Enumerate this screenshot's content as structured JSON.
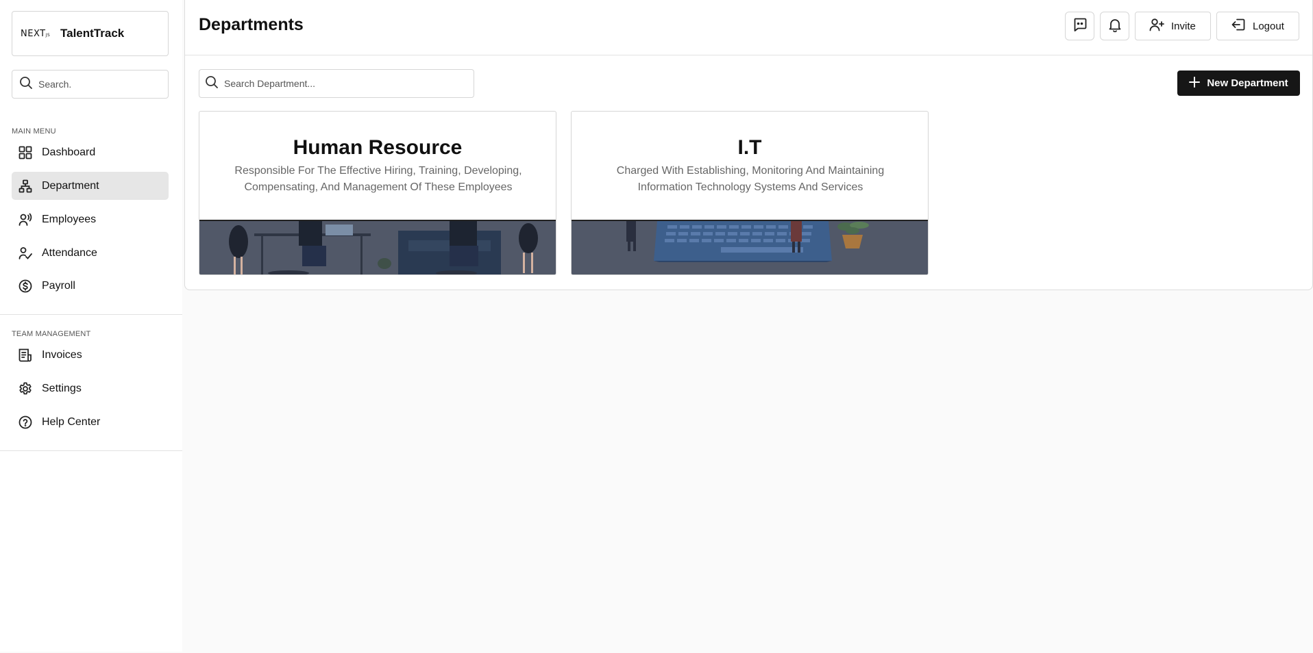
{
  "sidebar": {
    "brand_logo": "NEXT",
    "brand_logo_suffix": "JS",
    "brand_name": "TalentTrack",
    "search_placeholder": "Search.",
    "main_menu_label": "MAIN MENU",
    "main_menu": [
      {
        "label": "Dashboard",
        "icon": "dashboard-icon"
      },
      {
        "label": "Department",
        "icon": "department-icon",
        "active": true
      },
      {
        "label": "Employees",
        "icon": "employees-icon"
      },
      {
        "label": "Attendance",
        "icon": "attendance-icon"
      },
      {
        "label": "Payroll",
        "icon": "payroll-icon"
      }
    ],
    "team_menu_label": "TEAM MANAGEMENT",
    "team_menu": [
      {
        "label": "Invoices",
        "icon": "invoices-icon"
      },
      {
        "label": "Settings",
        "icon": "settings-icon"
      },
      {
        "label": "Help Center",
        "icon": "help-icon"
      }
    ]
  },
  "header": {
    "title": "Departments",
    "invite_label": "Invite",
    "logout_label": "Logout"
  },
  "main": {
    "search_placeholder": "Search Department...",
    "new_button_label": "New Department",
    "departments": [
      {
        "title": "Human Resource",
        "description": "Responsible For The Effective Hiring, Training, Developing, Compensating, And Management Of These Employees"
      },
      {
        "title": "I.T",
        "description": "Charged With Establishing, Monitoring And Maintaining Information Technology Systems And Services"
      }
    ]
  },
  "colors": {
    "accent": "#161616",
    "active_nav": "#e6e6e6",
    "card_image_overlay": "#4a5060"
  }
}
